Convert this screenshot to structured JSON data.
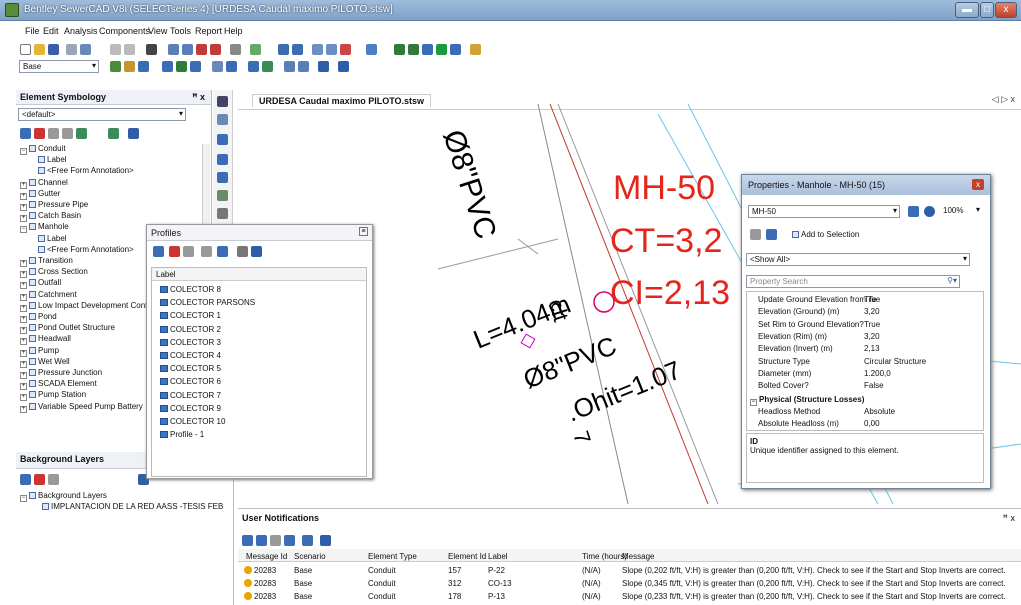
{
  "window": {
    "title": "Bentley SewerCAD V8i (SELECTseries 4) [URDESA Caudal maximo PILOTO.stsw]",
    "min": "▬",
    "max": "□",
    "close": "x"
  },
  "menu": [
    "File",
    "Edit",
    "Analysis",
    "Components",
    "View",
    "Tools",
    "Report",
    "Help"
  ],
  "toolbar": {
    "scenario": "Base"
  },
  "symbology": {
    "title": "Element Symbology",
    "pin": "ꟸ x",
    "combo": "<default>",
    "items": [
      "Conduit",
      "Label",
      "<Free Form Annotation>",
      "Channel",
      "Gutter",
      "Pressure Pipe",
      "Catch Basin",
      "Manhole",
      "Label",
      "<Free Form Annotation>",
      "Transition",
      "Cross Section",
      "Outfall",
      "Catchment",
      "Low Impact Development Contro",
      "Pond",
      "Pond Outlet Structure",
      "Headwall",
      "Pump",
      "Wet Well",
      "Pressure Junction",
      "SCADA Element",
      "Pump Station",
      "Variable Speed Pump Battery"
    ]
  },
  "background": {
    "title": "Background Layers",
    "items": [
      "Background Layers",
      "IMPLANTACION DE LA RED AASS -TESIS FEB"
    ]
  },
  "document": {
    "tab": "URDESA Caudal maximo PILOTO.stsw",
    "nav": "◁ ▷ x"
  },
  "drawing": {
    "pipe1": "Ø8\"PVC",
    "mh_label": "MH-50",
    "ct": "CT=3,2",
    "ci": "CI=2,13",
    "length": "L=4.04m",
    "pipe2": "Ø8\"PVC",
    "hit": ".Ohit=1.07",
    "clt": "clt",
    "seven": "7"
  },
  "profiles": {
    "title": "Profiles",
    "column": "Label",
    "rows": [
      "COLECTOR 8",
      "COLECTOR PARSONS",
      "COLECTOR 1",
      "COLECTOR 2",
      "COLECTOR 3",
      "COLECTOR 4",
      "COLECTOR 5",
      "COLECTOR 6",
      "COLECTOR 7",
      "COLECTOR 9",
      "COLECTOR 10",
      "Profile - 1"
    ]
  },
  "properties": {
    "title": "Properties - Manhole - MH-50 (15)",
    "element": "MH-50",
    "zoom": "100%",
    "add_selection": "Add to Selection",
    "filter": "<Show All>",
    "search_placeholder": "Property Search",
    "rows": [
      {
        "k": "Update Ground Elevation from Te",
        "v": "True"
      },
      {
        "k": "Elevation (Ground) (m)",
        "v": "3,20"
      },
      {
        "k": "Set Rim to Ground Elevation?",
        "v": "True"
      },
      {
        "k": "Elevation (Rim) (m)",
        "v": "3,20"
      },
      {
        "k": "Elevation (Invert) (m)",
        "v": "2,13"
      },
      {
        "k": "Structure Type",
        "v": "Circular Structure"
      },
      {
        "k": "Diameter (mm)",
        "v": "1.200,0"
      },
      {
        "k": "Bolted Cover?",
        "v": "False"
      }
    ],
    "section": "Physical (Structure Losses)",
    "rows2": [
      {
        "k": "Headloss Method",
        "v": "Absolute"
      },
      {
        "k": "Absolute Headloss (m)",
        "v": "0,00"
      }
    ],
    "desc_title": "ID",
    "desc_text": "Unique identifier assigned to this element."
  },
  "notifications": {
    "title": "User Notifications",
    "pin": "ꟸ x",
    "columns": [
      "Message Id",
      "Scenario",
      "Element Type",
      "Element Id",
      "Label",
      "Time (hours)",
      "Message"
    ],
    "rows": [
      {
        "id": "20283",
        "scenario": "Base",
        "type": "Conduit",
        "eid": "157",
        "label": "P-22",
        "time": "(N/A)",
        "msg": "Slope (0,202 ft/ft, V:H) is greater than (0,200 ft/ft, V:H). Check to see if the Start and Stop Inverts are correct."
      },
      {
        "id": "20283",
        "scenario": "Base",
        "type": "Conduit",
        "eid": "312",
        "label": "CO-13",
        "time": "(N/A)",
        "msg": "Slope (0,345 ft/ft, V:H) is greater than (0,200 ft/ft, V:H). Check to see if the Start and Stop Inverts are correct."
      },
      {
        "id": "20283",
        "scenario": "Base",
        "type": "Conduit",
        "eid": "178",
        "label": "P-13",
        "time": "(N/A)",
        "msg": "Slope (0,233 ft/ft, V:H) is greater than (0,200 ft/ft, V:H). Check to see if the Start and Stop Inverts are correct."
      }
    ]
  }
}
